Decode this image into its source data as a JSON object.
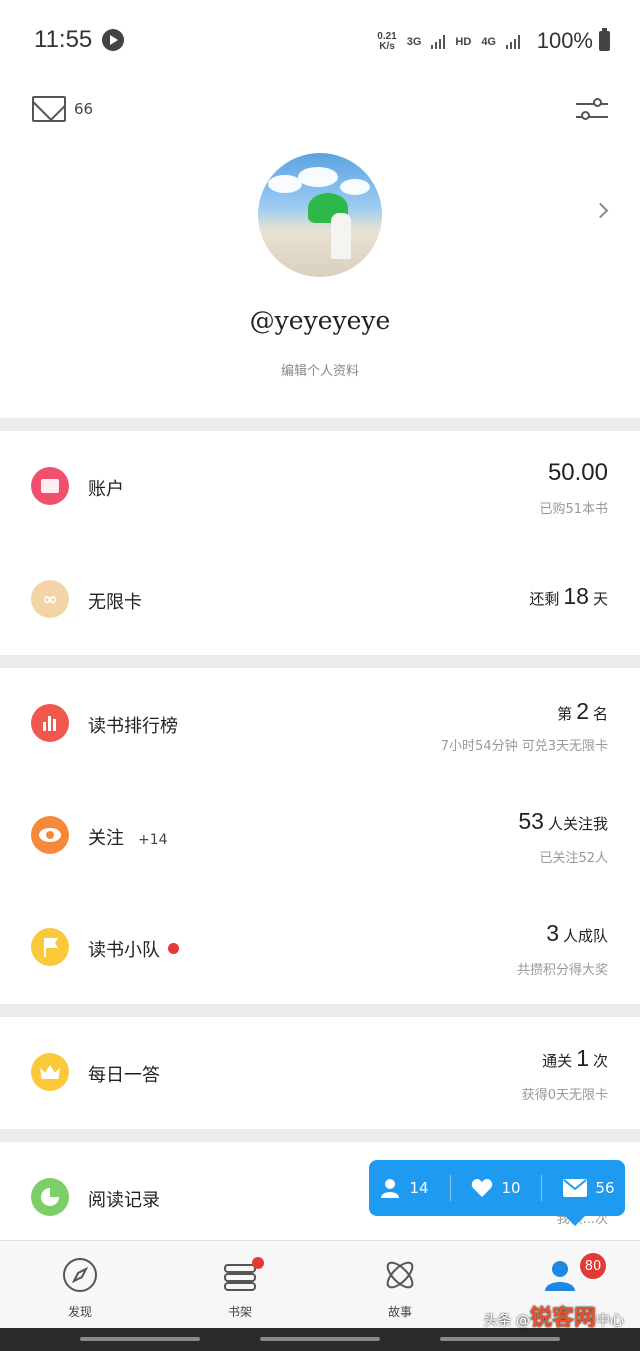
{
  "status_bar": {
    "time": "11:55",
    "net_speed_value": "0.21",
    "net_speed_unit": "K/s",
    "net1": "3G",
    "hd": "HD",
    "net2": "4G",
    "battery": "100%"
  },
  "header": {
    "mail_count": "66"
  },
  "profile": {
    "username": "@yeyeyeye",
    "edit_label": "编辑个人资料"
  },
  "rows": {
    "account": {
      "label": "账户",
      "main": "50.00",
      "sub": "已购51本书",
      "icon_color": "#f0506e"
    },
    "unlimited": {
      "label": "无限卡",
      "prefix": "还剩",
      "value": "18",
      "suffix": "天",
      "icon_color": "#f3d4a6"
    },
    "ranking": {
      "label": "读书排行榜",
      "prefix": "第",
      "value": "2",
      "suffix": "名",
      "sub": "7小时54分钟 可兑3天无限卡",
      "icon_color": "#f0584e"
    },
    "follow": {
      "label": "关注",
      "extra": "+14",
      "value": "53",
      "suffix": "人关注我",
      "sub": "已关注52人",
      "icon_color": "#f5893a"
    },
    "team": {
      "label": "读书小队",
      "value": "3",
      "suffix": "人成队",
      "sub": "共攒积分得大奖",
      "icon_color": "#f9c93a"
    },
    "daily": {
      "label": "每日一答",
      "prefix": "通关",
      "value": "1",
      "suffix": "次",
      "sub": "获得0天无限卡",
      "icon_color": "#f9c93a"
    },
    "history": {
      "label": "阅读记录",
      "sub": "我读...次",
      "icon_color": "#7bcf66"
    }
  },
  "popup": {
    "followers": "14",
    "likes": "10",
    "messages": "56"
  },
  "tabbar": {
    "tabs": [
      {
        "label": "发现"
      },
      {
        "label": "书架"
      },
      {
        "label": "故事"
      },
      {
        "label": ""
      }
    ],
    "me_badge": "80"
  },
  "watermark": {
    "prefix": "头条 @",
    "brand": "锐客网",
    "suffix": "中心"
  }
}
